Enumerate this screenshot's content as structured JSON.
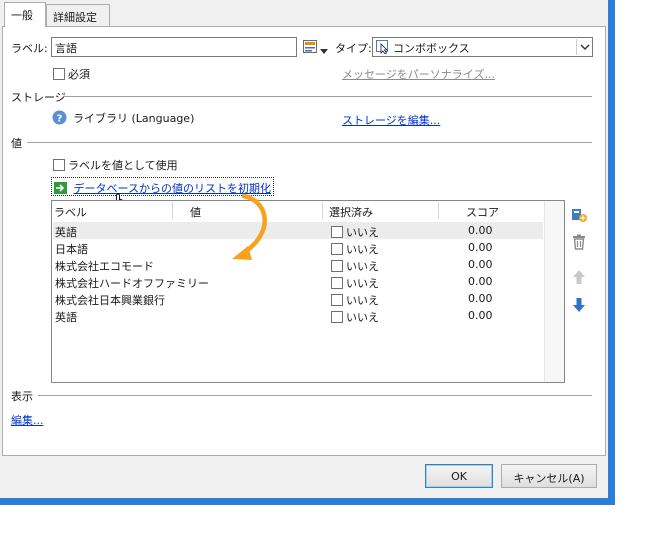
{
  "tabs": [
    {
      "label": "一般",
      "active": true
    },
    {
      "label": "詳細設定",
      "active": false
    }
  ],
  "label_field": {
    "label": "ラベル:",
    "value": "言語"
  },
  "type_field": {
    "label": "タイプ:",
    "value": "コンボボックス"
  },
  "required": {
    "label": "必須",
    "checked": false
  },
  "personalize_link": "メッセージをパーソナライズ...",
  "storage": {
    "section_title": "ストレージ",
    "value": "ライブラリ (Language)",
    "edit_link": "ストレージを編集..."
  },
  "values": {
    "section_title": "値",
    "use_label_as_value": {
      "label": "ラベルを値として使用",
      "checked": false
    },
    "init_link": "データベースからの値のリストを初期化",
    "columns": [
      "ラベル",
      "値",
      "選択済み",
      "スコア"
    ],
    "rows": [
      {
        "label": "英語",
        "value": "",
        "selected": "いいえ",
        "score": "0.00"
      },
      {
        "label": "日本語",
        "value": "",
        "selected": "いいえ",
        "score": "0.00"
      },
      {
        "label": "株式会社エコモード",
        "value": "",
        "selected": "いいえ",
        "score": "0.00"
      },
      {
        "label": "株式会社ハードオフファミリー",
        "value": "",
        "selected": "いいえ",
        "score": "0.00"
      },
      {
        "label": "株式会社日本興業銀行",
        "value": "",
        "selected": "いいえ",
        "score": "0.00"
      },
      {
        "label": "英語",
        "value": "",
        "selected": "いいえ",
        "score": "0.00"
      }
    ]
  },
  "display": {
    "section_title": "表示",
    "edit_link": "編集..."
  },
  "buttons": {
    "ok": "OK",
    "cancel": "キャンセル(A)"
  },
  "colors": {
    "accent_arrow": "#f5a31a",
    "frame": "#2b7fd8",
    "link": "#0033cc"
  }
}
